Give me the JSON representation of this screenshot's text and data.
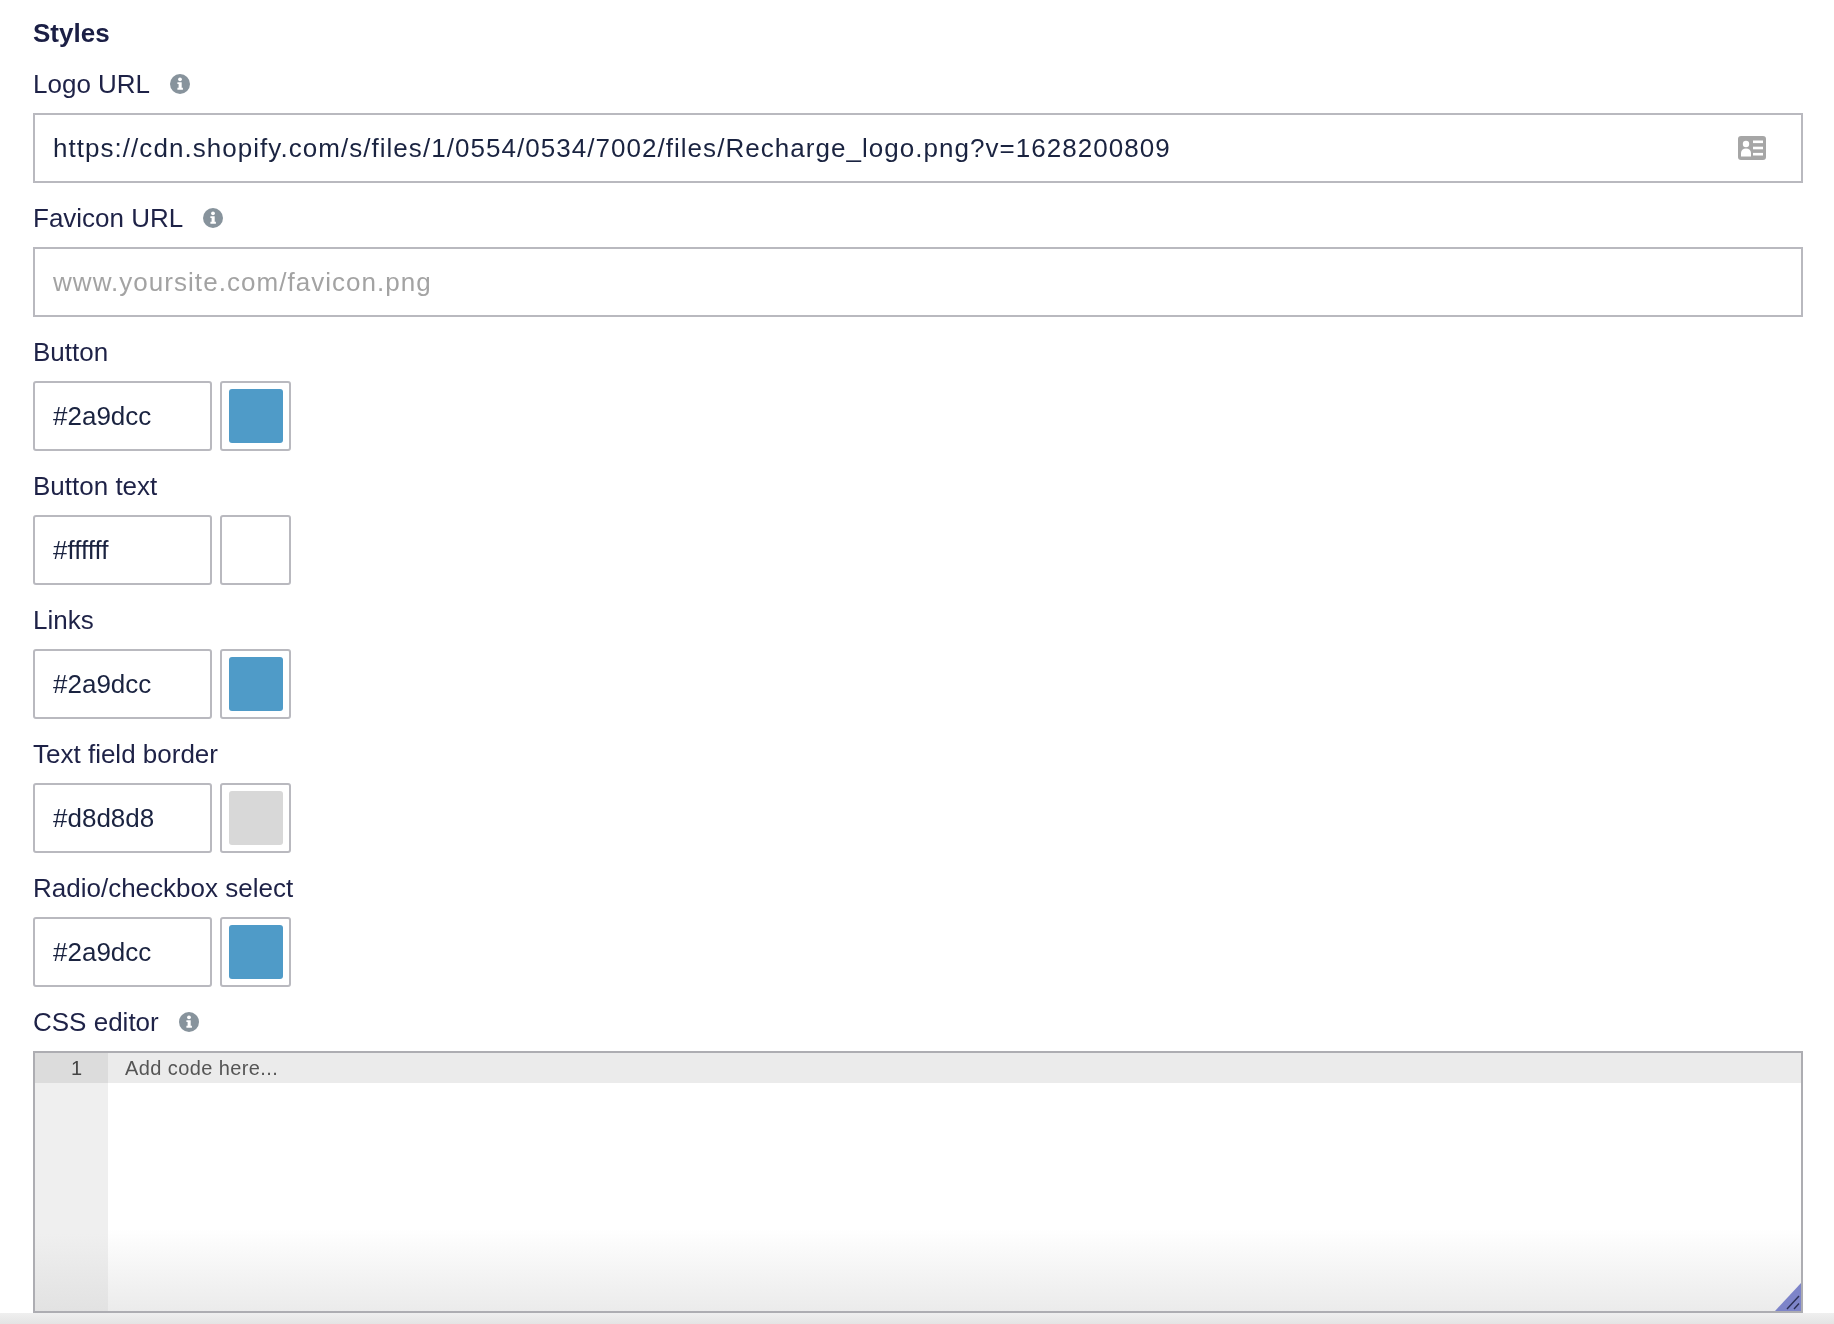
{
  "section_title": "Styles",
  "fields": [
    {
      "kind": "url",
      "label": "Logo URL",
      "info": true,
      "value": "https://cdn.shopify.com/s/files/1/0554/0534/7002/files/Recharge_logo.png?v=1628200809",
      "autofill": true
    },
    {
      "kind": "url",
      "label": "Favicon URL",
      "info": true,
      "placeholder": "www.yoursite.com/favicon.png"
    },
    {
      "kind": "color",
      "label": "Button",
      "value": "#2a9dcc",
      "color": "#4f9bc8"
    },
    {
      "kind": "color",
      "label": "Button text",
      "value": "#ffffff",
      "color": "#ffffff"
    },
    {
      "kind": "color",
      "label": "Links",
      "value": "#2a9dcc",
      "color": "#4f9bc8"
    },
    {
      "kind": "color",
      "label": "Text field border",
      "value": "#d8d8d8",
      "color": "#d8d8d8"
    },
    {
      "kind": "color",
      "label": "Radio/checkbox select",
      "value": "#2a9dcc",
      "color": "#4f9bc8"
    },
    {
      "kind": "code",
      "label": "CSS editor",
      "info": true,
      "line_numbers": [
        "1"
      ],
      "placeholder": "Add code here..."
    }
  ]
}
